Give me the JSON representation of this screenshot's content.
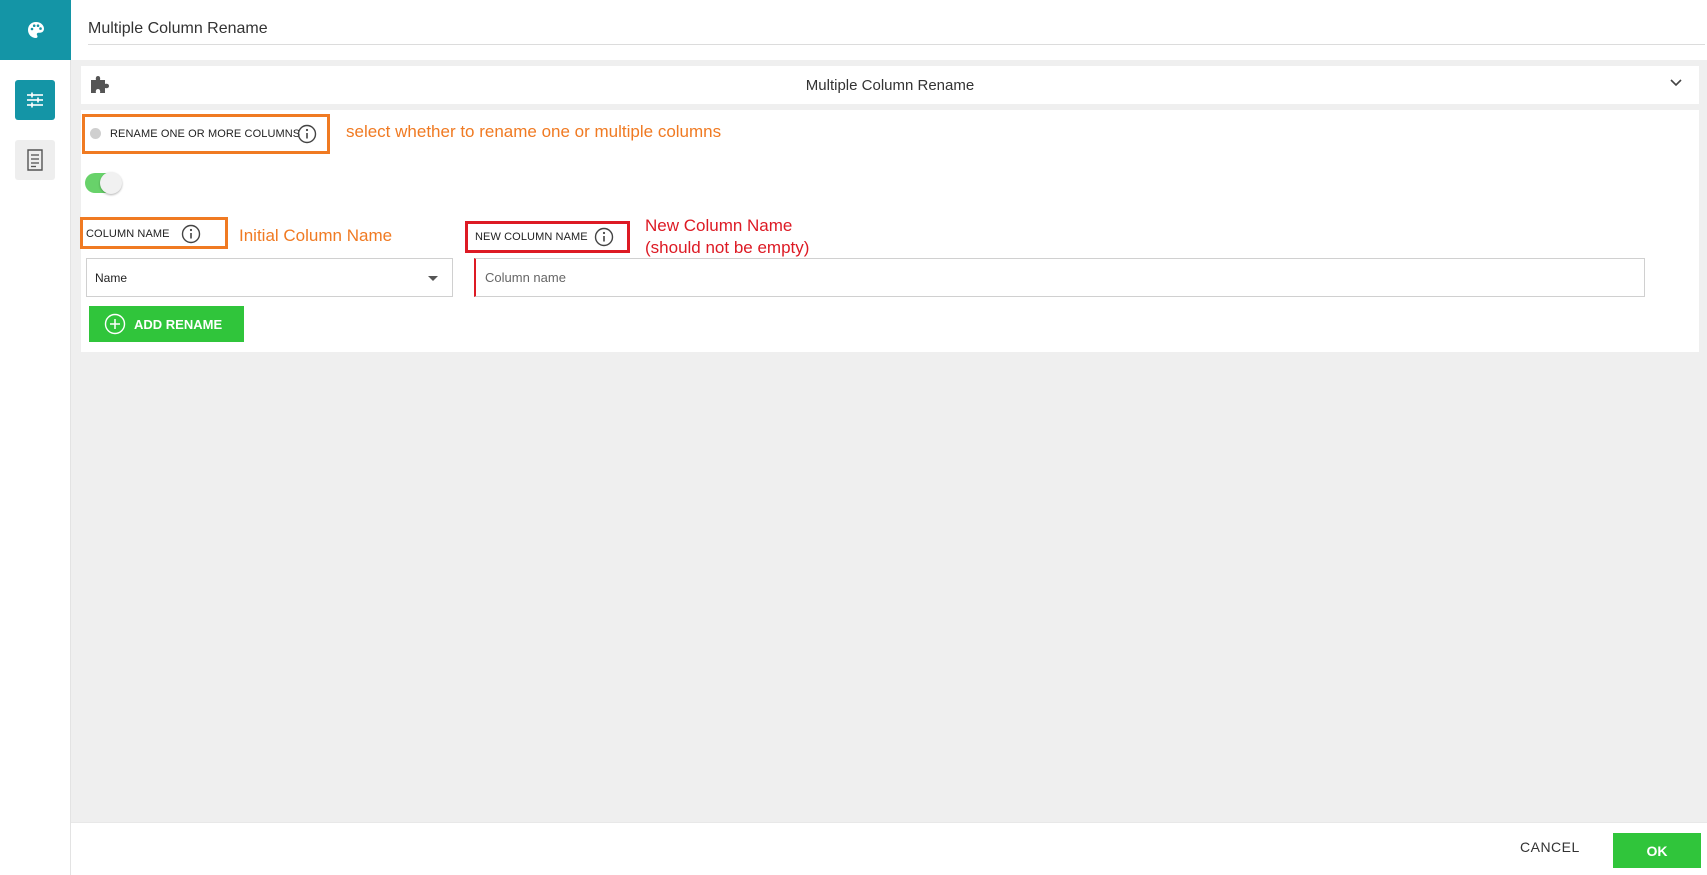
{
  "window": {
    "title": "Multiple Column Rename"
  },
  "rail": {
    "top_icon": "palette-icon",
    "items": [
      {
        "icon": "sliders-icon",
        "active": true
      },
      {
        "icon": "document-icon",
        "active": false
      }
    ]
  },
  "panel": {
    "icon": "puzzle-piece-icon",
    "title": "Multiple Column Rename",
    "collapse_icon": "chevron-down-icon"
  },
  "rename_mode": {
    "label": "RENAME ONE OR MORE COLUMNS",
    "info_icon": "info-icon",
    "annotation": "select whether to rename one or multiple columns",
    "toggle_on": true
  },
  "column_name": {
    "label": "COLUMN NAME",
    "info_icon": "info-icon",
    "annotation": "Initial Column Name",
    "selected_value": "Name"
  },
  "new_column_name": {
    "label": "NEW COLUMN NAME",
    "info_icon": "info-icon",
    "annotation_line1": "New Column Name",
    "annotation_line2": "(should not be empty)",
    "placeholder": "Column name",
    "value": ""
  },
  "add_rename": {
    "label": "ADD RENAME",
    "icon": "plus-circle-icon"
  },
  "footer": {
    "cancel_label": "CANCEL",
    "ok_label": "OK"
  },
  "colors": {
    "teal": "#1495a6",
    "green": "#30c53b",
    "annotation_orange": "#f07a22",
    "annotation_red": "#dd1a24",
    "workspace_gray": "#efefef"
  }
}
